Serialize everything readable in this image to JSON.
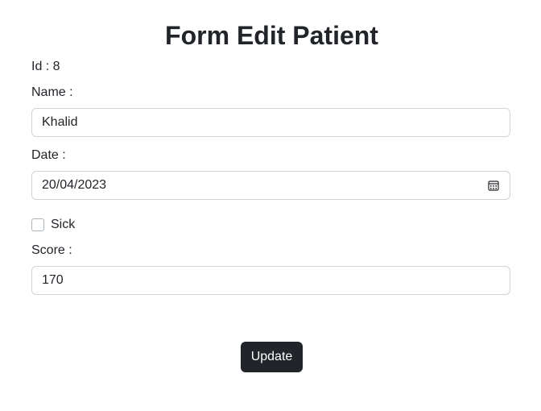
{
  "form": {
    "title": "Form Edit Patient",
    "id_text": "Id : 8",
    "name_label": "Name :",
    "name_value": "Khalid",
    "date_label": "Date :",
    "date_value": "20/04/2023",
    "sick_label": "Sick",
    "sick_checked": false,
    "score_label": "Score :",
    "score_value": "170",
    "submit_label": "Update"
  },
  "icons": {
    "date": "calendar-icon"
  },
  "colors": {
    "text": "#212529",
    "button_bg": "#212529",
    "button_text": "#ffffff",
    "input_border": "#ced4da"
  }
}
